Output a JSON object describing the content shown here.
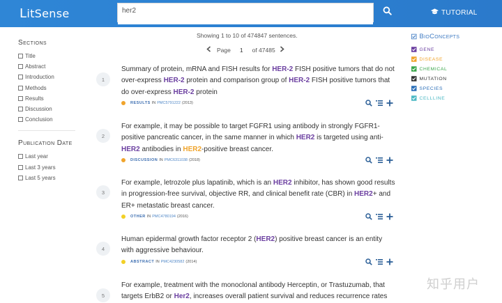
{
  "header": {
    "logo_first": "L",
    "logo_rest": "itSense",
    "search_value": "her2",
    "tutorial_label": "TUTORIAL"
  },
  "sidebar": {
    "sections_title": "Sections",
    "sections": [
      "Title",
      "Abstract",
      "Introduction",
      "Methods",
      "Results",
      "Discussion",
      "Conclusion"
    ],
    "date_title": "Publication Date",
    "dates": [
      "Last year",
      "Last 3 years",
      "Last 5 years"
    ]
  },
  "pagination": {
    "showing": "Showing 1 to 10 of 474847 sentences.",
    "page_label": "Page",
    "page_value": "1",
    "of_label": "of 47485"
  },
  "results": [
    {
      "num": "1",
      "section": "RESULTS",
      "in": "IN",
      "pmc": "PMC5791222",
      "year": "(2013)",
      "dot": "#f0a42c"
    },
    {
      "num": "2",
      "section": "DISCUSSION",
      "in": "IN",
      "pmc": "PMC6311038",
      "year": "(2018)",
      "dot": "#f0a42c"
    },
    {
      "num": "3",
      "section": "OTHER",
      "in": "IN",
      "pmc": "PMC4780194",
      "year": "(2016)",
      "dot": "#f2d026"
    },
    {
      "num": "4",
      "section": "ABSTRACT",
      "in": "IN",
      "pmc": "PMC4230582",
      "year": "(2014)",
      "dot": "#f2d026"
    },
    {
      "num": "5"
    }
  ],
  "sentences": {
    "r1": [
      "Summary of protein, mRNA and FISH results for ",
      "HER-2",
      " FISH positive tumors that do not over-express ",
      "HER-2",
      " protein and comparison group of ",
      "HER-2",
      " FISH positive tumors that do over-express ",
      "HER-2",
      " protein"
    ],
    "r2": [
      "For example, it may be possible to target FGFR1 using antibody in strongly FGFR1-positive pancreatic cancer, in the same manner in which ",
      "HER2",
      " is targeted using anti-",
      "HER2",
      " antibodies in ",
      "HER2",
      "-positive breast cancer."
    ],
    "r3": [
      "For example, letrozole plus lapatinib, which is an ",
      "HER2",
      " inhibitor, has shown good results in progression-free survival, objective RR, and clinical benefit rate (CBR) in ",
      "HER2",
      "+ and ER+ metastatic breast cancer."
    ],
    "r4": [
      "Human epidermal growth factor receptor 2 (",
      "HER2",
      ") positive breast cancer is an entity with aggressive behaviour."
    ],
    "r5": [
      "For example, treatment with the monoclonal antibody Herceptin, or Trastuzumab, that targets ErbB2 or ",
      "Her2",
      ", increases overall patient survival and reduces recurrence rates"
    ]
  },
  "bioconcepts": {
    "title": "BioConcepts",
    "title_color": "#3e7ac2",
    "items": [
      {
        "label": "GENE",
        "color": "#6b3fa0"
      },
      {
        "label": "DISEASE",
        "color": "#f0a42c"
      },
      {
        "label": "CHEMICAL",
        "color": "#3aa64a"
      },
      {
        "label": "MUTATION",
        "color": "#333333"
      },
      {
        "label": "SPECIES",
        "color": "#2b6fb8"
      },
      {
        "label": "CELLLINE",
        "color": "#4cb8c4"
      }
    ]
  },
  "watermark": "知乎用户"
}
